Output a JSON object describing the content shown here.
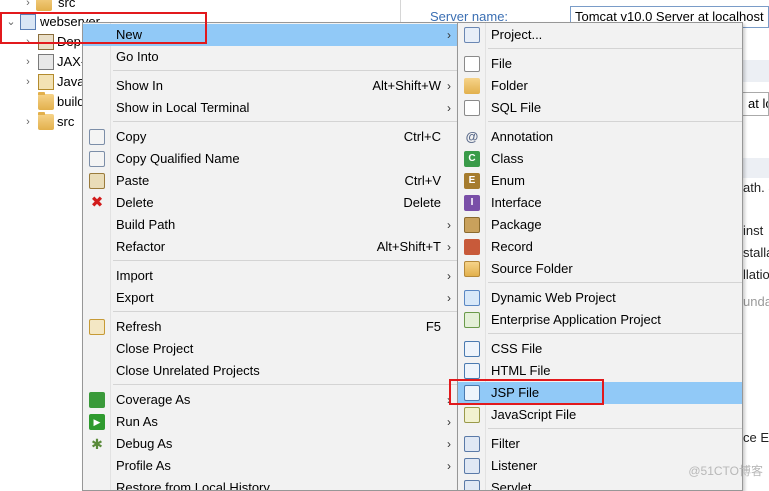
{
  "tree": {
    "rows": [
      {
        "label": "src",
        "chevron": "›",
        "icon": "folder-icon"
      },
      {
        "label": "webserver",
        "chevron": "⌄",
        "icon": "project-icon"
      },
      {
        "label": "Dep",
        "chevron": "›",
        "icon": "deployment-descriptor-icon"
      },
      {
        "label": "JAX-",
        "chevron": "›",
        "icon": "jax-ws-icon"
      },
      {
        "label": "Java",
        "chevron": "›",
        "icon": "java-resources-icon"
      },
      {
        "label": "build",
        "chevron": "",
        "icon": "folder-icon"
      },
      {
        "label": "src",
        "chevron": "›",
        "icon": "folder-icon"
      }
    ]
  },
  "editor": {
    "server_name_label": "Server name:",
    "server_name_value": "Tomcat v10.0 Server at localhost",
    "fragment_at": "at lo",
    "fragment_ath": "ath. S",
    "fragment_inst": "inst",
    "fragment_stall": "stalla",
    "fragment_llation": "llatio",
    "fragment_unda": "unda",
    "fragment_ce": "ce E"
  },
  "menu": {
    "items": [
      {
        "label": "New",
        "accel": "",
        "submenu": true,
        "icon": ""
      },
      {
        "label": "Go Into",
        "accel": "",
        "submenu": false,
        "icon": ""
      },
      {
        "label": "Show In",
        "accel": "Alt+Shift+W",
        "submenu": true,
        "icon": ""
      },
      {
        "label": "Show in Local Terminal",
        "accel": "",
        "submenu": true,
        "icon": ""
      },
      {
        "label": "Copy",
        "accel": "Ctrl+C",
        "submenu": false,
        "icon": "copy-icon"
      },
      {
        "label": "Copy Qualified Name",
        "accel": "",
        "submenu": false,
        "icon": "copy-qualified-icon"
      },
      {
        "label": "Paste",
        "accel": "Ctrl+V",
        "submenu": false,
        "icon": "paste-icon"
      },
      {
        "label": "Delete",
        "accel": "Delete",
        "submenu": false,
        "icon": "delete-icon"
      },
      {
        "label": "Build Path",
        "accel": "",
        "submenu": true,
        "icon": ""
      },
      {
        "label": "Refactor",
        "accel": "Alt+Shift+T",
        "submenu": true,
        "icon": ""
      },
      {
        "label": "Import",
        "accel": "",
        "submenu": true,
        "icon": ""
      },
      {
        "label": "Export",
        "accel": "",
        "submenu": true,
        "icon": ""
      },
      {
        "label": "Refresh",
        "accel": "F5",
        "submenu": false,
        "icon": "refresh-icon"
      },
      {
        "label": "Close Project",
        "accel": "",
        "submenu": false,
        "icon": ""
      },
      {
        "label": "Close Unrelated Projects",
        "accel": "",
        "submenu": false,
        "icon": ""
      },
      {
        "label": "Coverage As",
        "accel": "",
        "submenu": true,
        "icon": "coverage-icon"
      },
      {
        "label": "Run As",
        "accel": "",
        "submenu": true,
        "icon": "run-icon"
      },
      {
        "label": "Debug As",
        "accel": "",
        "submenu": true,
        "icon": "debug-icon"
      },
      {
        "label": "Profile As",
        "accel": "",
        "submenu": true,
        "icon": ""
      },
      {
        "label": "Restore from Local History...",
        "accel": "",
        "submenu": false,
        "icon": ""
      }
    ]
  },
  "submenu": {
    "items": [
      {
        "label": "Project...",
        "icon": "project-wizard-icon"
      },
      {
        "label": "File",
        "icon": "file-icon"
      },
      {
        "label": "Folder",
        "icon": "folder-icon"
      },
      {
        "label": "SQL File",
        "icon": "sql-file-icon"
      },
      {
        "label": "Annotation",
        "icon": "annotation-icon",
        "glyph": "@"
      },
      {
        "label": "Class",
        "icon": "class-icon",
        "glyph": "C"
      },
      {
        "label": "Enum",
        "icon": "enum-icon",
        "glyph": "E"
      },
      {
        "label": "Interface",
        "icon": "interface-icon",
        "glyph": "I"
      },
      {
        "label": "Package",
        "icon": "package-icon"
      },
      {
        "label": "Record",
        "icon": "record-icon"
      },
      {
        "label": "Source Folder",
        "icon": "source-folder-icon"
      },
      {
        "label": "Dynamic Web Project",
        "icon": "dynamic-web-project-icon"
      },
      {
        "label": "Enterprise Application Project",
        "icon": "enterprise-application-icon"
      },
      {
        "label": "CSS File",
        "icon": "css-file-icon"
      },
      {
        "label": "HTML File",
        "icon": "html-file-icon"
      },
      {
        "label": "JSP File",
        "icon": "jsp-file-icon"
      },
      {
        "label": "JavaScript File",
        "icon": "javascript-file-icon"
      },
      {
        "label": "Filter",
        "icon": "filter-icon"
      },
      {
        "label": "Listener",
        "icon": "listener-icon"
      },
      {
        "label": "Servlet",
        "icon": "servlet-icon"
      }
    ]
  },
  "watermark": "@51CTO博客",
  "colors": {
    "highlight": "#91c9f7",
    "annotation_red": "#e2191c",
    "link_blue": "#3b6fb3"
  }
}
